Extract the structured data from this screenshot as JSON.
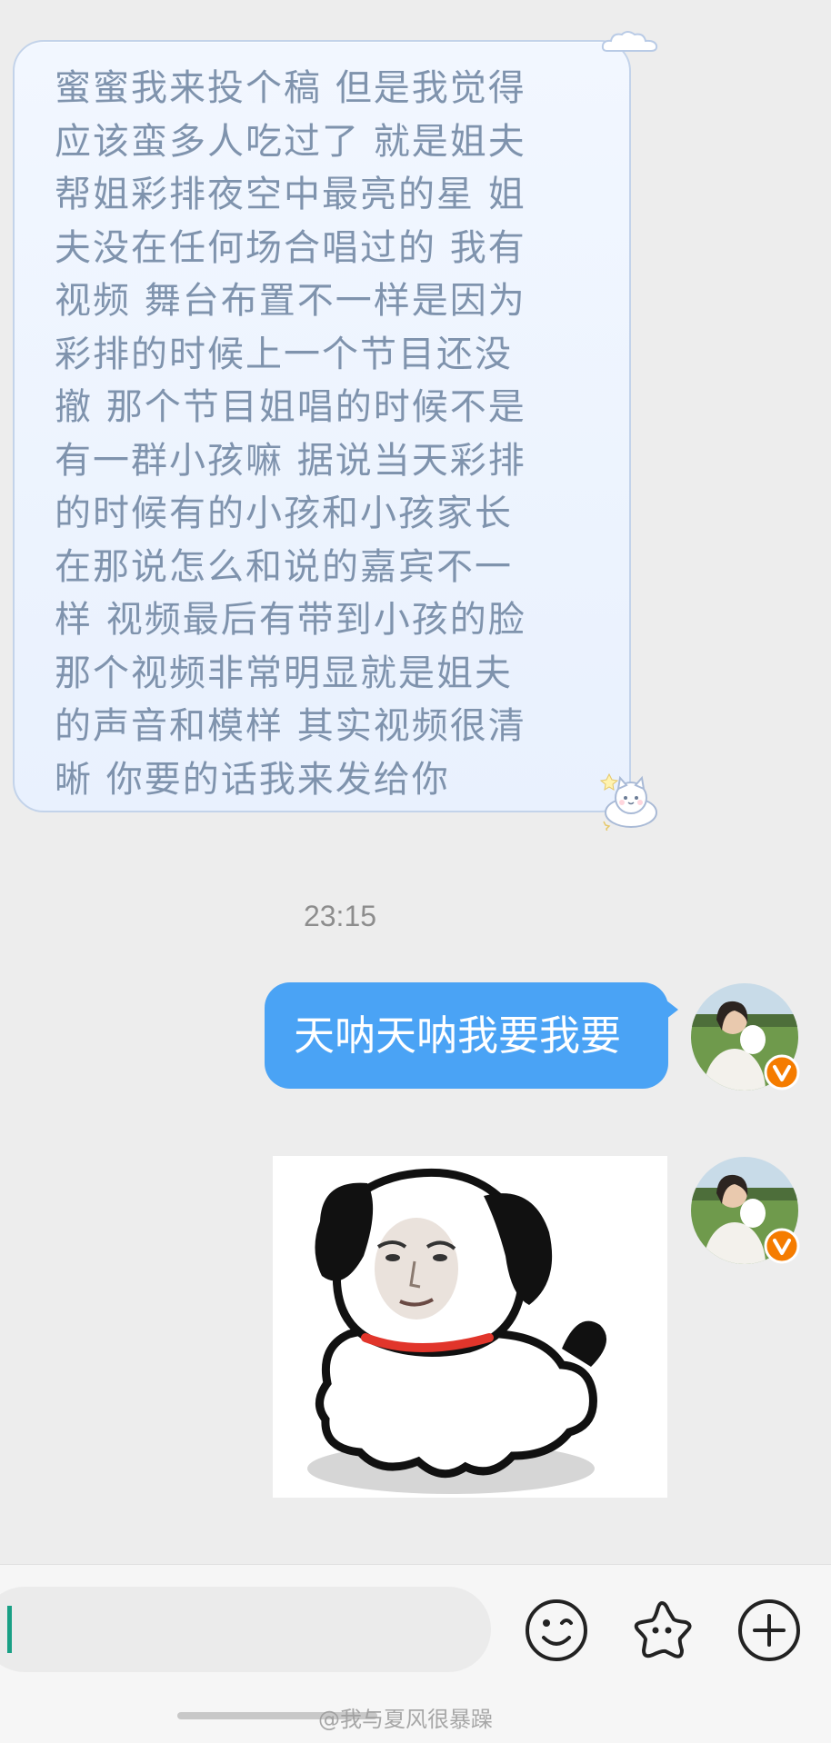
{
  "chat": {
    "incoming_message": "蜜蜜我来投个稿 但是我觉得\n应该蛮多人吃过了 就是姐夫\n帮姐彩排夜空中最亮的星 姐\n夫没在任何场合唱过的 我有\n视频 舞台布置不一样是因为\n彩排的时候上一个节目还没\n撤 那个节目姐唱的时候不是\n有一群小孩嘛 据说当天彩排\n的时候有的小孩和小孩家长\n在那说怎么和说的嘉宾不一\n样 视频最后有带到小孩的脸\n那个视频非常明显就是姐夫\n的声音和模样 其实视频很清\n晰 你要的话我来发给你",
    "timestamp": "23:15",
    "outgoing_message": "天呐天呐我要我要"
  },
  "input_bar": {
    "placeholder": ""
  },
  "watermark": "@我与夏风很暴躁",
  "colors": {
    "background": "#ededed",
    "incoming_bubble": "#eaf2fe",
    "incoming_text": "#7f93ad",
    "outgoing_bubble": "#4aa3f5",
    "verified_badge": "#f57c00",
    "caret": "#1aa086"
  },
  "icons": [
    "cloud-icon",
    "cat-icon",
    "verified-badge-icon",
    "emoji-icon",
    "sticker-icon",
    "plus-icon"
  ]
}
